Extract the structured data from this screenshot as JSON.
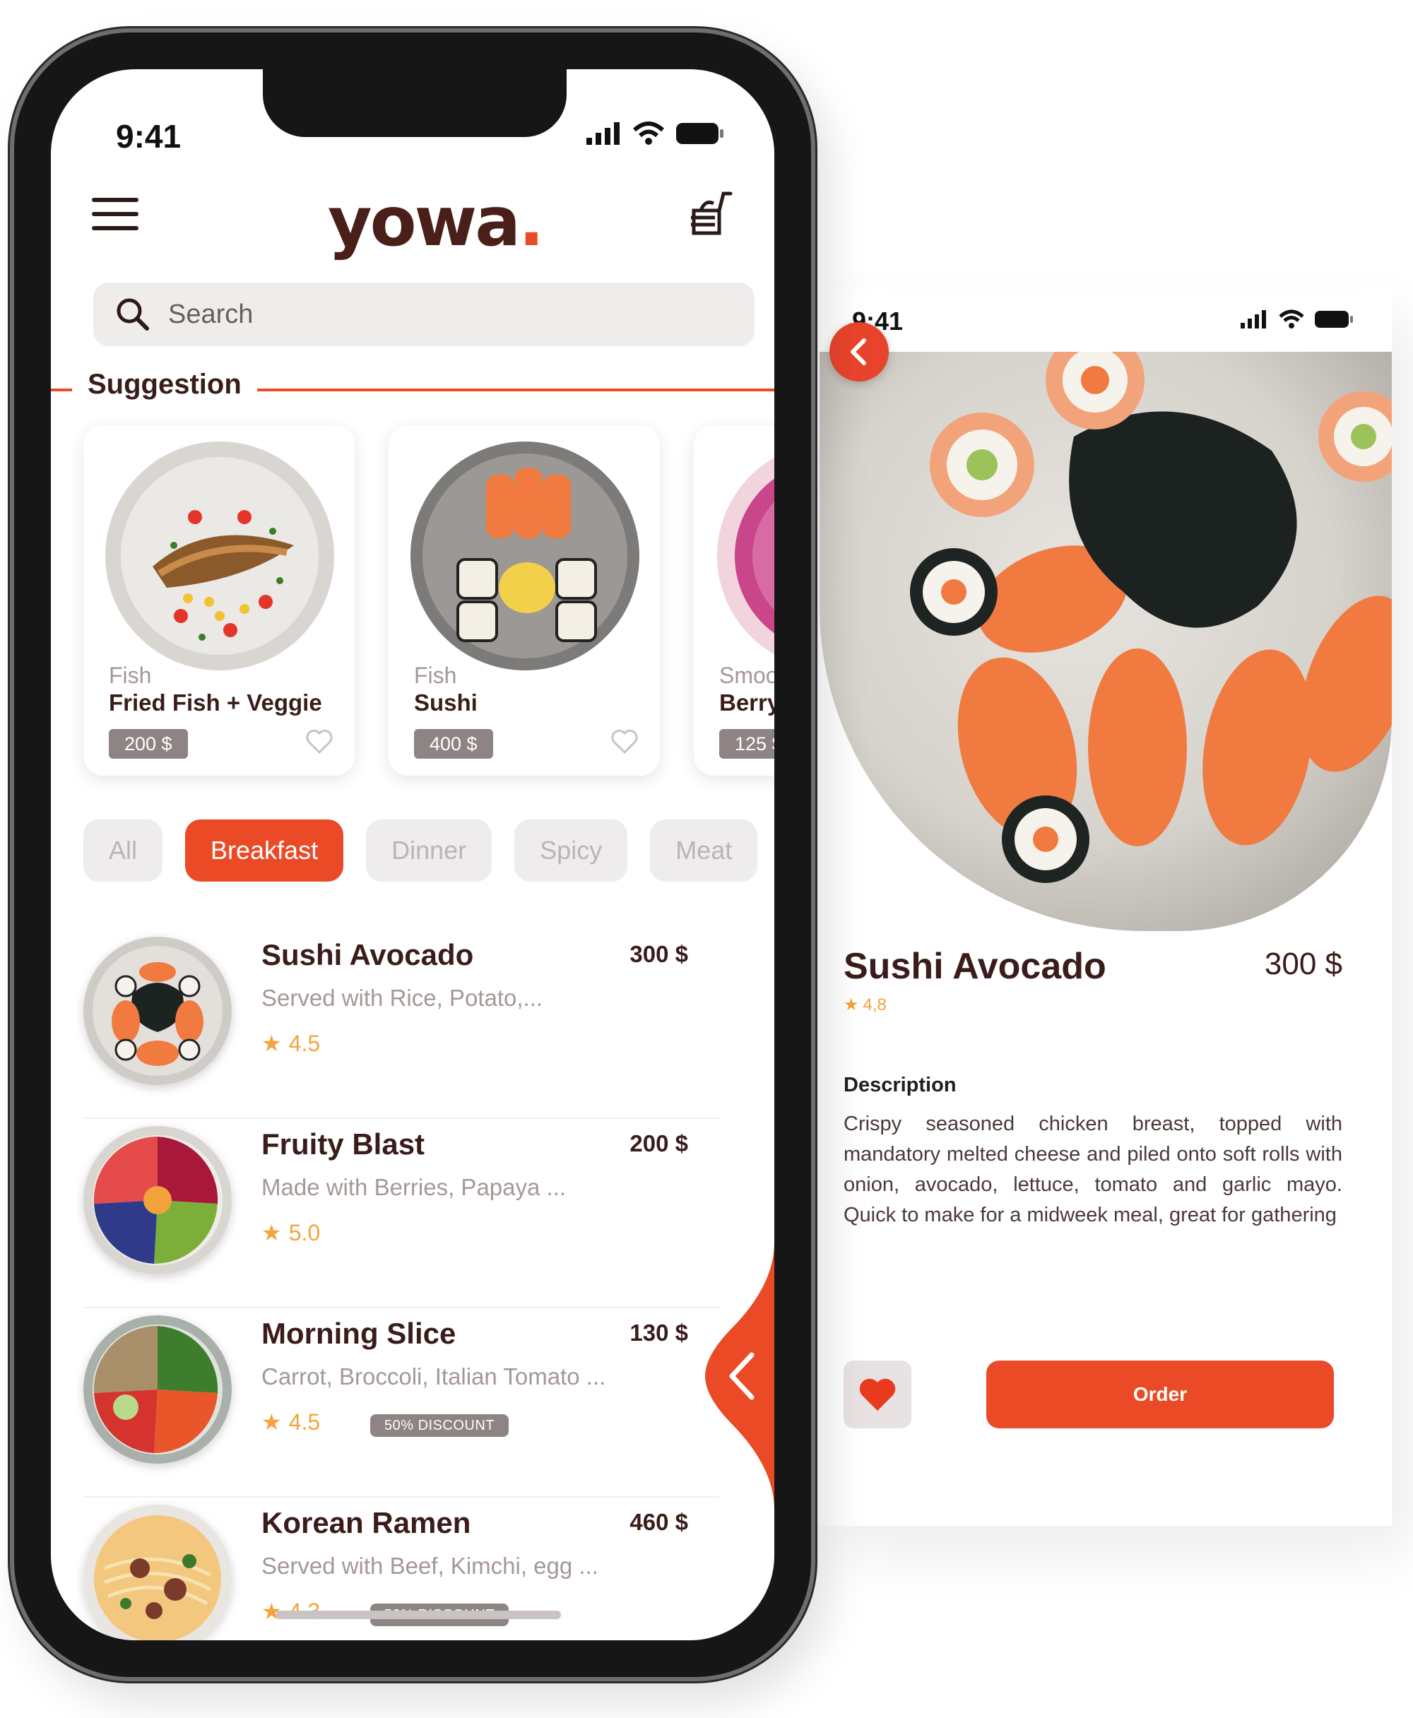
{
  "colors": {
    "accent": "#ea4a25",
    "brand": "#4a1f1a",
    "star": "#f3a43b",
    "muted": "#a49896"
  },
  "phone": {
    "status": {
      "time": "9:41"
    },
    "header": {
      "logo_text": "yowa",
      "logo_dot": ".",
      "menu_icon": "hamburger-icon",
      "cart_icon": "cart-icon"
    },
    "search": {
      "placeholder": "Search"
    },
    "suggestion": {
      "title": "Suggestion",
      "cards": [
        {
          "category": "Fish",
          "name": "Fried Fish + Veggie",
          "price": "200 $"
        },
        {
          "category": "Fish",
          "name": "Sushi",
          "price": "400 $"
        },
        {
          "category": "Smoo",
          "name": "Berry",
          "price": "125 $"
        }
      ]
    },
    "chips": [
      "All",
      "Breakfast",
      "Dinner",
      "Spicy",
      "Meat"
    ],
    "active_chip": "Breakfast",
    "items": [
      {
        "title": "Sushi Avocado",
        "price": "300 $",
        "desc": "Served with Rice, Potato,...",
        "rating": "4.5",
        "badge": ""
      },
      {
        "title": "Fruity Blast",
        "price": "200 $",
        "desc": "Made with Berries, Papaya ...",
        "rating": "5.0",
        "badge": ""
      },
      {
        "title": "Morning Slice",
        "price": "130 $",
        "desc": "Carrot, Broccoli, Italian Tomato ...",
        "rating": "4.5",
        "badge": "50% DISCOUNT"
      },
      {
        "title": "Korean Ramen",
        "price": "460 $",
        "desc": "Served with Beef, Kimchi, egg ...",
        "rating": "4.3",
        "badge": "50% DISCOUNT"
      }
    ]
  },
  "detail": {
    "status": {
      "time": "9:41"
    },
    "title": "Sushi Avocado",
    "price": "300 $",
    "rating": "4,8",
    "description_heading": "Description",
    "description": "Crispy seasoned chicken breast, topped with mandatory melted cheese and piled onto soft rolls with onion, avocado, lettuce, tomato and garlic mayo. Quick to make for a midweek meal, great for gathering",
    "order_label": "Order"
  }
}
